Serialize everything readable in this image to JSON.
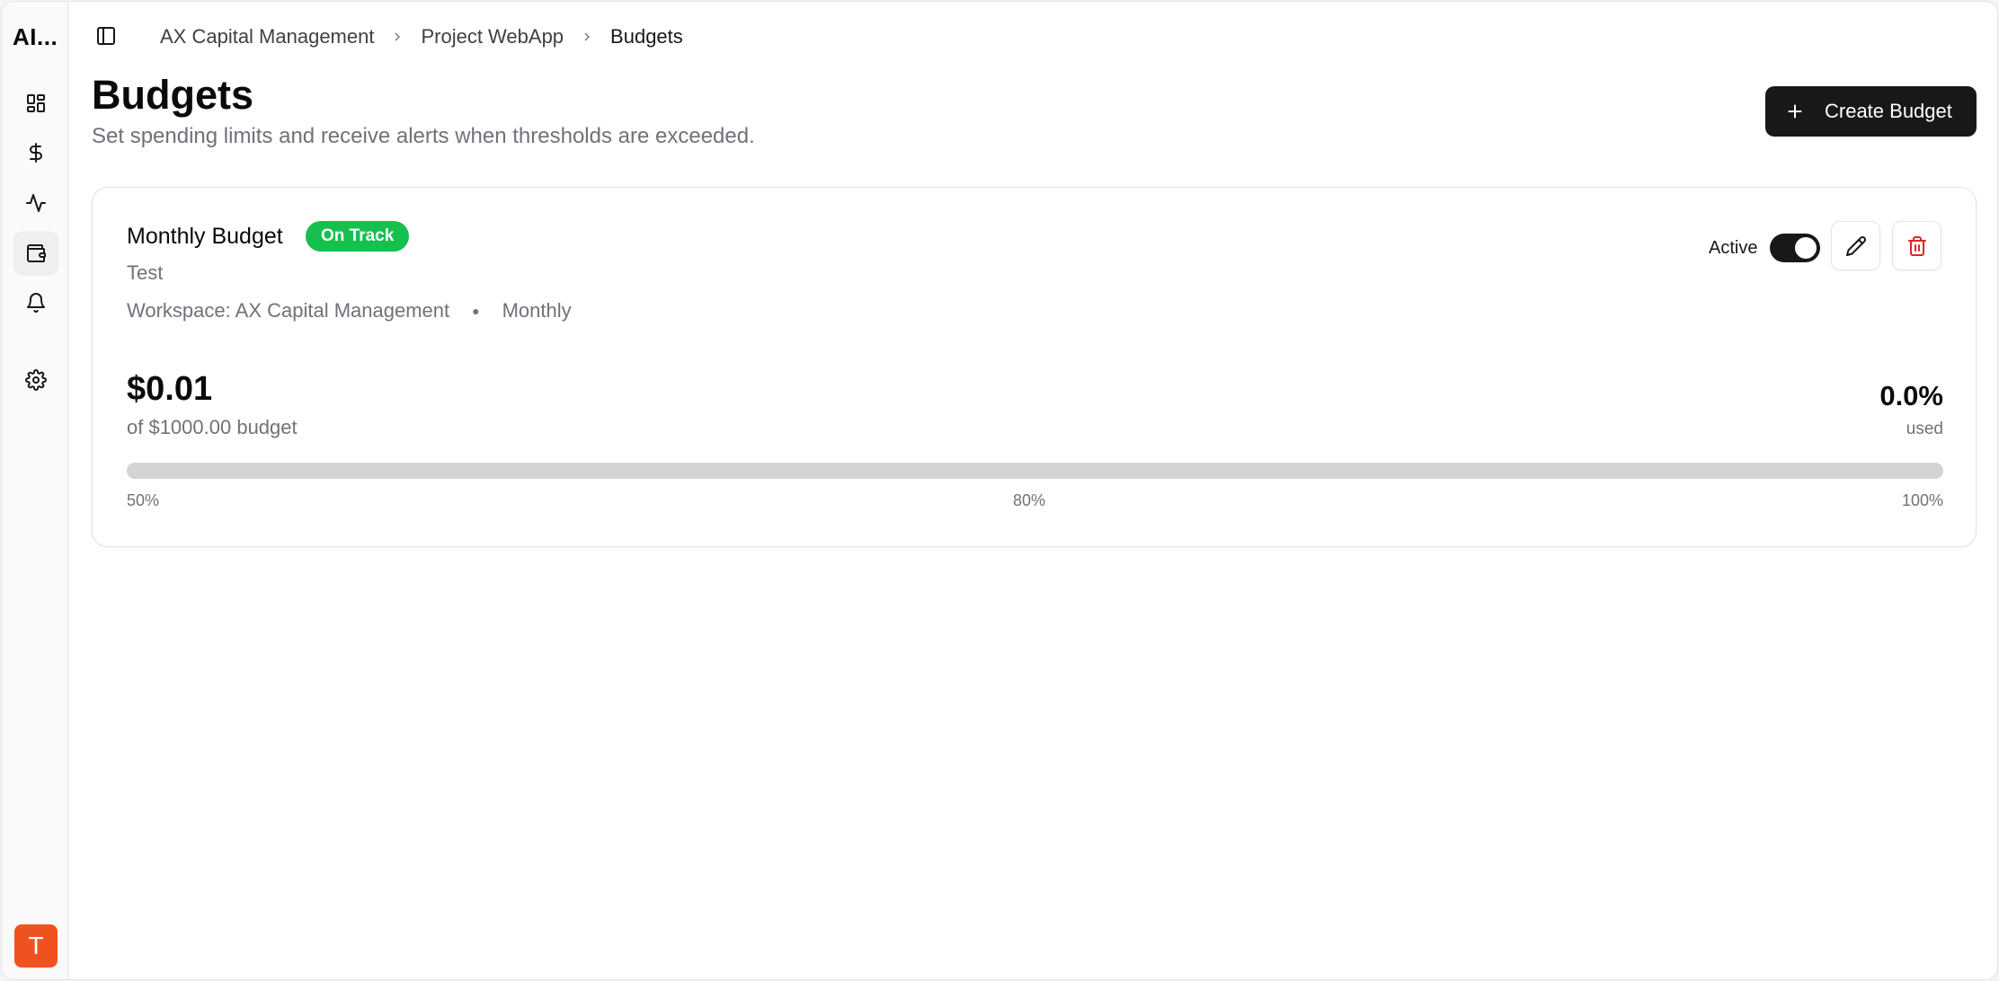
{
  "app": {
    "brand": "AI..."
  },
  "sidebar": {
    "items": [
      {
        "name": "dashboard",
        "icon": "layout-dashboard-icon"
      },
      {
        "name": "costs",
        "icon": "dollar-sign-icon"
      },
      {
        "name": "activity",
        "icon": "activity-icon"
      },
      {
        "name": "budgets",
        "icon": "wallet-icon",
        "active": true
      },
      {
        "name": "alerts",
        "icon": "bell-icon"
      },
      {
        "name": "settings",
        "icon": "gear-icon"
      }
    ],
    "avatar_initial": "T",
    "avatar_color": "#f0521f"
  },
  "breadcrumb": [
    "AX Capital Management",
    "Project WebApp",
    "Budgets"
  ],
  "header": {
    "title": "Budgets",
    "subtitle": "Set spending limits and receive alerts when thresholds are exceeded.",
    "create_label": "Create Budget"
  },
  "budget_card": {
    "name": "Monthly Budget",
    "status": "On Track",
    "status_color": "#16c04f",
    "description": "Test",
    "workspace": "Workspace: AX Capital Management",
    "period": "Monthly",
    "active_label": "Active",
    "active": true,
    "spent": "$0.01",
    "budget_text": "of $1000.00 budget",
    "percent_used": "0.0%",
    "used_label": "used",
    "progress_fraction": 0.0,
    "thresholds": [
      "50%",
      "80%",
      "100%"
    ]
  }
}
